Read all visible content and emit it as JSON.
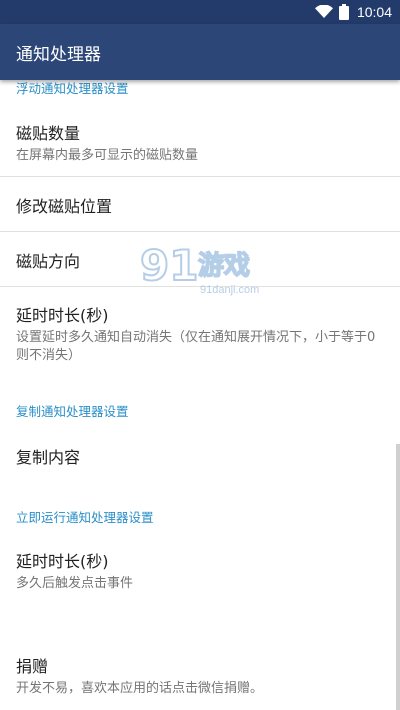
{
  "status_bar": {
    "time": "10:04"
  },
  "app_bar": {
    "title": "通知处理器"
  },
  "sections": {
    "floating": {
      "header": "浮动通知处理器设置",
      "items": [
        {
          "title": "磁贴数量",
          "summary": "在屏幕内最多可显示的磁贴数量"
        },
        {
          "title": "修改磁贴位置"
        },
        {
          "title": "磁贴方向"
        },
        {
          "title": "延时时长(秒)",
          "summary": "设置延时多久通知自动消失（仅在通知展开情况下，小于等于0则不消失）"
        }
      ]
    },
    "copy": {
      "header": "复制通知处理器设置",
      "items": [
        {
          "title": "复制内容"
        }
      ]
    },
    "run": {
      "header": "立即运行通知处理器设置",
      "items": [
        {
          "title": "延时时长(秒)",
          "summary": "多久后触发点击事件"
        },
        {
          "title": "捐赠",
          "summary": "开发不易，喜欢本应用的话点击微信捐赠。"
        }
      ]
    }
  },
  "watermark": {
    "brand": "91游戏",
    "url": "91danji.com"
  },
  "colors": {
    "app_bar": "#2b4677",
    "status_bar": "#233b6b",
    "accent": "#2a8fc8"
  }
}
